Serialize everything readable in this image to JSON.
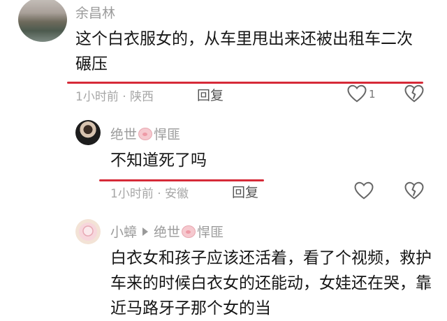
{
  "comments": [
    {
      "name": "余昌林",
      "text": "这个白衣服女的，从车里甩出来还被出租车二次碾压",
      "time": "1小时前",
      "location": "陕西",
      "reply": "回复",
      "like_count": "1",
      "icons": [
        "heart-outline-icon",
        "broken-heart-icon"
      ]
    },
    {
      "name_prefix": "绝世",
      "name_suffix": "悍匪",
      "name_emoji": "pig-face",
      "text": "不知道死了吗",
      "time": "1小时前",
      "location": "安徽",
      "reply": "回复",
      "icons": [
        "heart-outline-icon",
        "broken-heart-icon"
      ]
    },
    {
      "name": "小蟑",
      "reply_to_prefix": "绝世",
      "reply_to_suffix": "悍匪",
      "text": "白衣女和孩子应该还活着，看了个视频，救护车来的时候白衣女的还能动，女娃还在哭，靠近马路牙子那个女的当"
    }
  ],
  "separator": "·",
  "colors": {
    "underline": "#d62a38",
    "meta": "#a6a6a6"
  }
}
